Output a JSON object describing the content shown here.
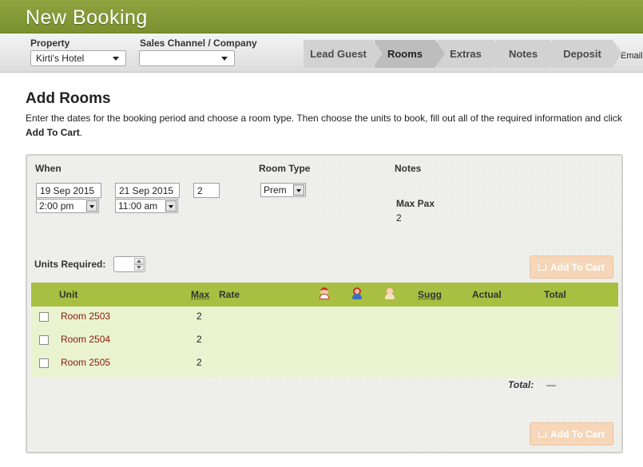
{
  "header": {
    "title": "New Booking"
  },
  "toolbar": {
    "property_label": "Property",
    "property_value": "Kirti's Hotel",
    "channel_label": "Sales Channel / Company",
    "channel_value": "",
    "steps": [
      "Lead Guest",
      "Rooms",
      "Extras",
      "Notes",
      "Deposit"
    ],
    "active_step": "Rooms",
    "email_step": "Email"
  },
  "page": {
    "title": "Add Rooms",
    "intro_text": "Enter the dates for the booking period and choose a room type. Then choose the units to book, fill out all of the required information and click ",
    "intro_bold": "Add To Cart",
    "intro_end": "."
  },
  "when": {
    "label": "When",
    "start_date": "19 Sep 2015",
    "end_date": "21 Sep 2015",
    "nights": "2",
    "start_time": "2:00 pm",
    "end_time": "11:00 am"
  },
  "room_type": {
    "label": "Room Type",
    "value": "Prem"
  },
  "notes": {
    "label": "Notes",
    "max_pax_label": "Max Pax",
    "max_pax_value": "2"
  },
  "units_required": {
    "label": "Units Required:",
    "value": ""
  },
  "add_to_cart_label": "Add To Cart",
  "table": {
    "columns": {
      "unit": "Unit",
      "max": "Max",
      "rate": "Rate",
      "sugg": "Sugg",
      "actual": "Actual",
      "total": "Total"
    },
    "guest_icons": [
      "adult-guest-icon",
      "child-guest-icon",
      "infant-guest-icon"
    ],
    "rows": [
      {
        "unit": "Room 2503",
        "max": "2"
      },
      {
        "unit": "Room 2504",
        "max": "2"
      },
      {
        "unit": "Room 2505",
        "max": "2"
      }
    ],
    "total_label": "Total:",
    "total_value": "—"
  },
  "colors": {
    "brand_green": "#7b9130",
    "table_header": "#a8bf42",
    "table_body": "#e9f3cf",
    "unit_link": "#8b1a0e",
    "cart_disabled": "#f6d6b8"
  }
}
